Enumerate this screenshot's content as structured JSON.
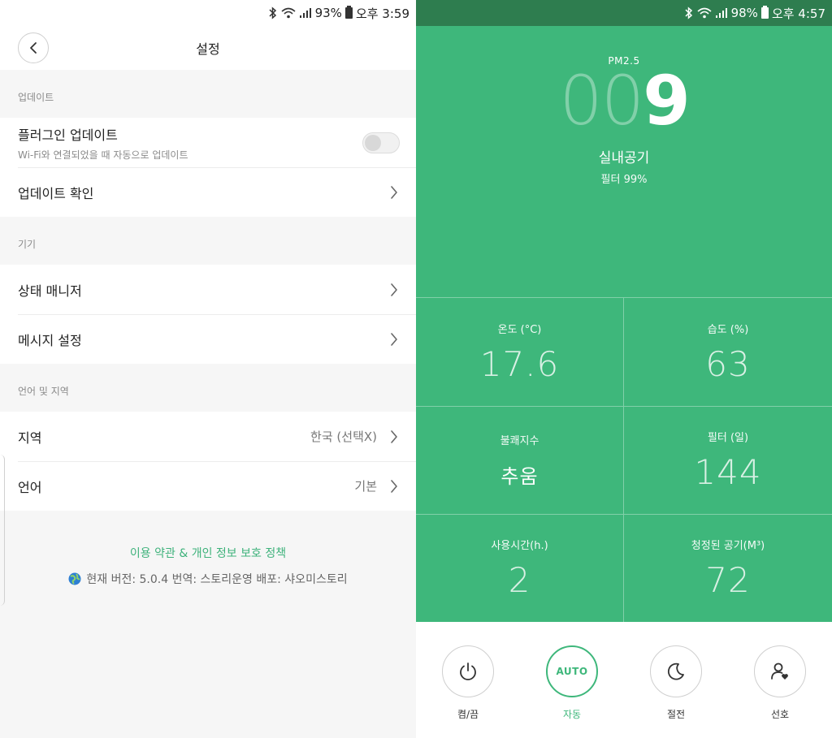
{
  "left": {
    "statusbar": {
      "battery": "93%",
      "time": "오후 3:59"
    },
    "header": {
      "title": "설정"
    },
    "sections": [
      {
        "label": "업데이트"
      },
      {
        "label": "기기"
      },
      {
        "label": "언어 및 지역"
      }
    ],
    "rows": {
      "plugin_update": {
        "title": "플러그인 업데이트",
        "subtitle": "Wi-Fi와 연결되었을 때 자동으로 업데이트",
        "toggle_on": false
      },
      "check_update": {
        "title": "업데이트 확인"
      },
      "status_manager": {
        "title": "상태 매니저"
      },
      "message_settings": {
        "title": "메시지 설정"
      },
      "region": {
        "title": "지역",
        "value": "한국 (선택X)"
      },
      "language": {
        "title": "언어",
        "value": "기본"
      }
    },
    "footer": {
      "link": "이용 약관 & 개인 정보 보호 정책",
      "info": "현재 버전: 5.0.4 번역: 스토리운영 배포: 샤오미스토리"
    }
  },
  "right": {
    "statusbar": {
      "battery": "98%",
      "time": "오후 4:57"
    },
    "hero": {
      "pm_label": "PM2.5",
      "pm_dim": "00",
      "pm_bright": "9",
      "title": "실내공기",
      "subtitle": "필터 99%"
    },
    "stats": [
      {
        "label": "온도 (°C)",
        "value": "17.6"
      },
      {
        "label": "습도 (%)",
        "value": "63"
      },
      {
        "label": "불쾌지수",
        "value": "추움"
      },
      {
        "label": "필터 (일)",
        "value": "144"
      },
      {
        "label": "사용시간(h.)",
        "value": "2"
      },
      {
        "label": "청정된 공기(M³)",
        "value": "72"
      }
    ],
    "controls": [
      {
        "label": "켬/끔"
      },
      {
        "label": "자동",
        "inner": "AUTO"
      },
      {
        "label": "절전"
      },
      {
        "label": "선호"
      }
    ]
  },
  "colors": {
    "accent": "#3eb77b",
    "status_green": "#2e7d4f"
  },
  "icons": [
    "back-chevron-icon",
    "bluetooth-icon",
    "wifi-icon",
    "signal-icon",
    "battery-icon",
    "chevron-right-icon",
    "globe-icon",
    "power-icon",
    "moon-icon",
    "user-heart-icon"
  ]
}
